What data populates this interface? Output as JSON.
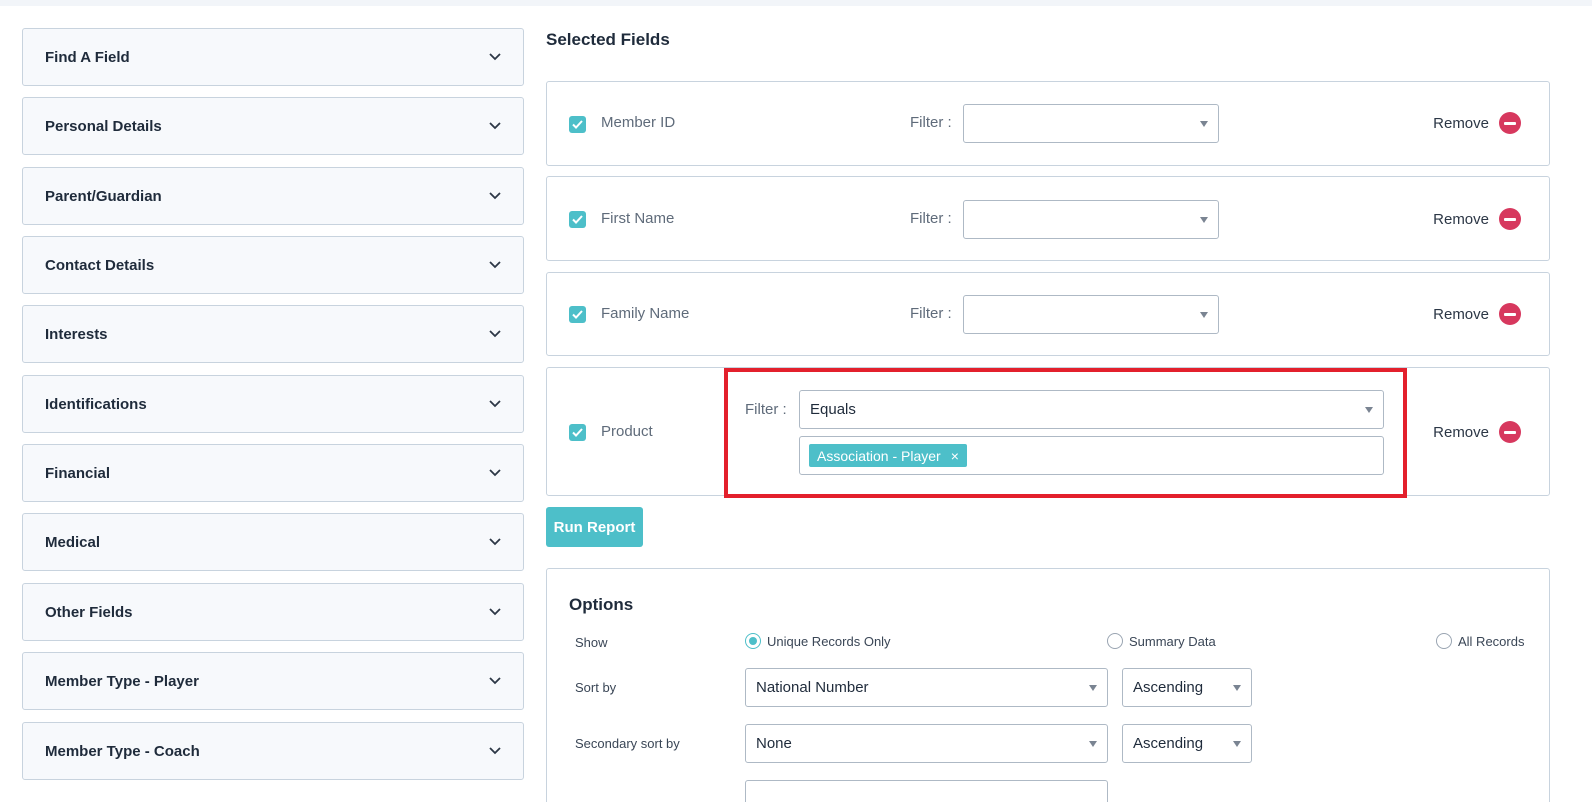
{
  "sidebar": {
    "items": [
      {
        "label": "Find A Field"
      },
      {
        "label": "Personal Details"
      },
      {
        "label": "Parent/Guardian"
      },
      {
        "label": "Contact Details"
      },
      {
        "label": "Interests"
      },
      {
        "label": "Identifications"
      },
      {
        "label": "Financial"
      },
      {
        "label": "Medical"
      },
      {
        "label": "Other Fields"
      },
      {
        "label": "Member Type - Player"
      },
      {
        "label": "Member Type - Coach"
      }
    ]
  },
  "selected": {
    "title": "Selected Fields",
    "filter_label": "Filter :",
    "remove_label": "Remove",
    "fields": [
      {
        "name": "Member ID",
        "filter_value": ""
      },
      {
        "name": "First Name",
        "filter_value": ""
      },
      {
        "name": "Family Name",
        "filter_value": ""
      },
      {
        "name": "Product",
        "filter_value": "Equals",
        "tag": "Association - Player",
        "tag_remove": "×"
      }
    ]
  },
  "run_report_label": "Run Report",
  "options": {
    "title": "Options",
    "show_label": "Show",
    "show_options": [
      "Unique Records Only",
      "Summary Data",
      "All Records"
    ],
    "selected_show": "Unique Records Only",
    "sort_by_label": "Sort by",
    "sort_by_value": "National Number",
    "sort_order_value": "Ascending",
    "secondary_sort_label": "Secondary sort by",
    "secondary_sort_value": "None",
    "secondary_order_value": "Ascending"
  },
  "colors": {
    "accent": "#4dbfc9",
    "remove": "#d7385e",
    "highlight": "#e3202c"
  }
}
